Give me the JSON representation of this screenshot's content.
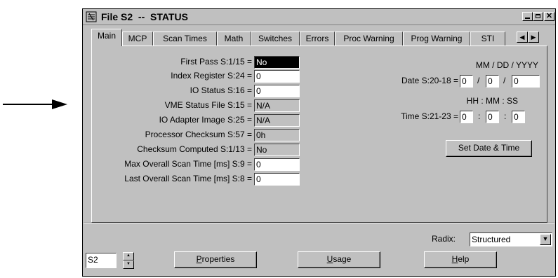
{
  "window": {
    "title": "File S2  --  STATUS",
    "controls": [
      "minimize",
      "maximize",
      "close"
    ]
  },
  "tabs": [
    {
      "label": "Main",
      "active": true
    },
    {
      "label": "MCP"
    },
    {
      "label": "Scan Times"
    },
    {
      "label": "Math"
    },
    {
      "label": "Switches"
    },
    {
      "label": "Errors"
    },
    {
      "label": "Proc Warning"
    },
    {
      "label": "Prog Warning"
    },
    {
      "label": "STI"
    }
  ],
  "fields": [
    {
      "label": "First Pass S:1/15 =",
      "value": "No"
    },
    {
      "label": "Index Register S:24 =",
      "value": "0"
    },
    {
      "label": "IO Status S:16 =",
      "value": "0"
    },
    {
      "label": "VME Status File S:15 =",
      "value": "N/A"
    },
    {
      "label": "IO Adapter Image S:25 =",
      "value": "N/A"
    },
    {
      "label": "Processor Checksum S:57 =",
      "value": "0h"
    },
    {
      "label": "Checksum Computed S:1/13 =",
      "value": "No"
    },
    {
      "label": "Max Overall Scan Time  [ms] S:9 =",
      "value": "0"
    },
    {
      "label": "Last Overall Scan Time  [ms] S:8 =",
      "value": "0"
    }
  ],
  "date": {
    "header": "MM / DD / YYYY",
    "label": "Date S:20-18 =",
    "month": "0",
    "day": "0",
    "year": "0",
    "sep": "/"
  },
  "time": {
    "header": "HH  :  MM  :  SS",
    "label": "Time S:21-23 =",
    "hour": "0",
    "minute": "0",
    "second": "0",
    "sep": ":"
  },
  "set_date_button": "Set Date & Time",
  "radix": {
    "label": "Radix:",
    "value": "Structured"
  },
  "file_selector": {
    "value": "S2"
  },
  "buttons": {
    "properties": {
      "accel": "P",
      "rest": "roperties"
    },
    "usage": {
      "accel": "U",
      "rest": "sage"
    },
    "help": {
      "accel": "H",
      "rest": "elp"
    }
  }
}
